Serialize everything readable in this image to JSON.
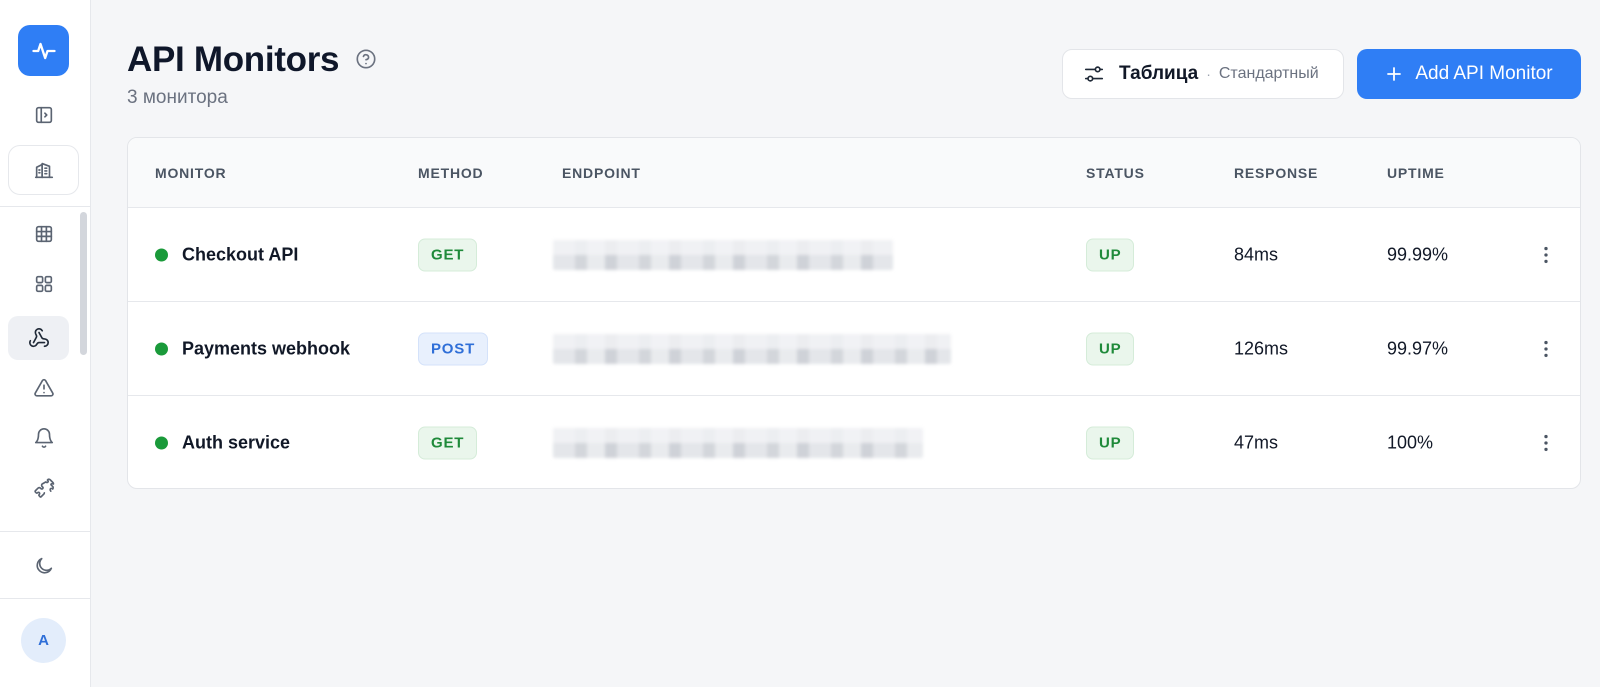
{
  "sidebar": {
    "items": [
      {
        "icon": "activity-icon"
      },
      {
        "icon": "panel-toggle-icon"
      },
      {
        "icon": "building-icon"
      },
      {
        "icon": "grid-icon"
      },
      {
        "icon": "dashboard-icon"
      },
      {
        "icon": "webhook-icon"
      },
      {
        "icon": "alert-triangle-icon"
      },
      {
        "icon": "bell-icon"
      },
      {
        "icon": "puzzle-icon"
      },
      {
        "icon": "moon-icon"
      }
    ],
    "avatar_initial": "A"
  },
  "header": {
    "title": "API Monitors",
    "subtitle": "3 монитора",
    "view_label": "Таблица",
    "view_separator": "·",
    "view_sub": "Стандартный",
    "add_button": "Add API Monitor"
  },
  "table": {
    "columns": [
      "MONITOR",
      "METHOD",
      "ENDPOINT",
      "STATUS",
      "RESPONSE",
      "UPTIME"
    ],
    "rows": [
      {
        "name": "Checkout API",
        "method": "GET",
        "status": "UP",
        "response": "84ms",
        "uptime": "99.99%"
      },
      {
        "name": "Payments webhook",
        "method": "POST",
        "status": "UP",
        "response": "126ms",
        "uptime": "99.97%"
      },
      {
        "name": "Auth service",
        "method": "GET",
        "status": "UP",
        "response": "47ms",
        "uptime": "100%"
      }
    ]
  },
  "colors": {
    "accent": "#2f7ef5",
    "status_up": "#1a9a3a"
  }
}
